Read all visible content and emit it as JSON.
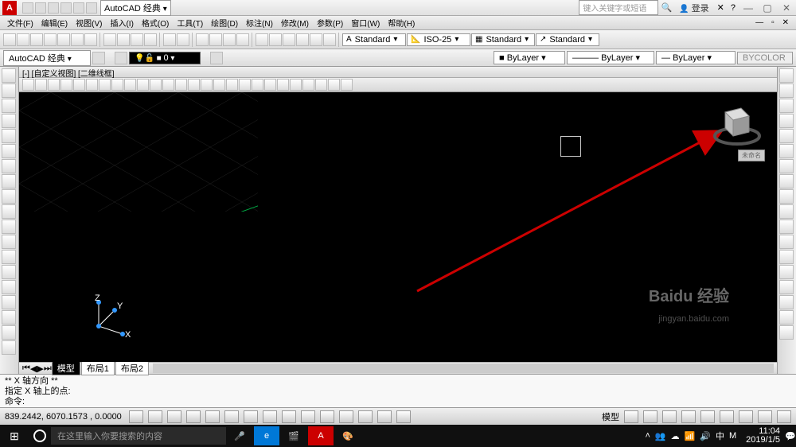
{
  "app": {
    "name": "AutoCAD",
    "workspace": "AutoCAD 经典",
    "search_placeholder": "键入关键字或短语",
    "login": "登录"
  },
  "menus": [
    "文件(F)",
    "编辑(E)",
    "视图(V)",
    "插入(I)",
    "格式(O)",
    "工具(T)",
    "绘图(D)",
    "标注(N)",
    "修改(M)",
    "参数(P)",
    "窗口(W)",
    "帮助(H)"
  ],
  "styles": {
    "text": "Standard",
    "dim": "ISO-25",
    "table": "Standard",
    "mleader": "Standard"
  },
  "props": {
    "layer": "ByLayer",
    "ltype": "ByLayer",
    "lweight": "ByLayer",
    "color": "BYCOLOR",
    "layer0": "0"
  },
  "viewport": {
    "label": "[-] [自定义视图] [二维线框]"
  },
  "tabs": {
    "model": "模型",
    "layout1": "布局1",
    "layout2": "布局2"
  },
  "cmd": {
    "l1": "** X 轴方向 **",
    "l2": "指定 X 轴上的点:",
    "prompt": "命令:"
  },
  "status": {
    "coords": "839.2442, 6070.1573 , 0.0000",
    "model": "模型"
  },
  "taskbar": {
    "search": "在这里输入你要搜索的内容",
    "time": "11:04",
    "date": "2019/1/5"
  },
  "watermark": {
    "main": "Baidu 经验",
    "sub": "jingyan.baidu.com"
  },
  "ucs": {
    "x": "X",
    "y": "Y",
    "z": "Z"
  },
  "viewcube_label": "未命名"
}
